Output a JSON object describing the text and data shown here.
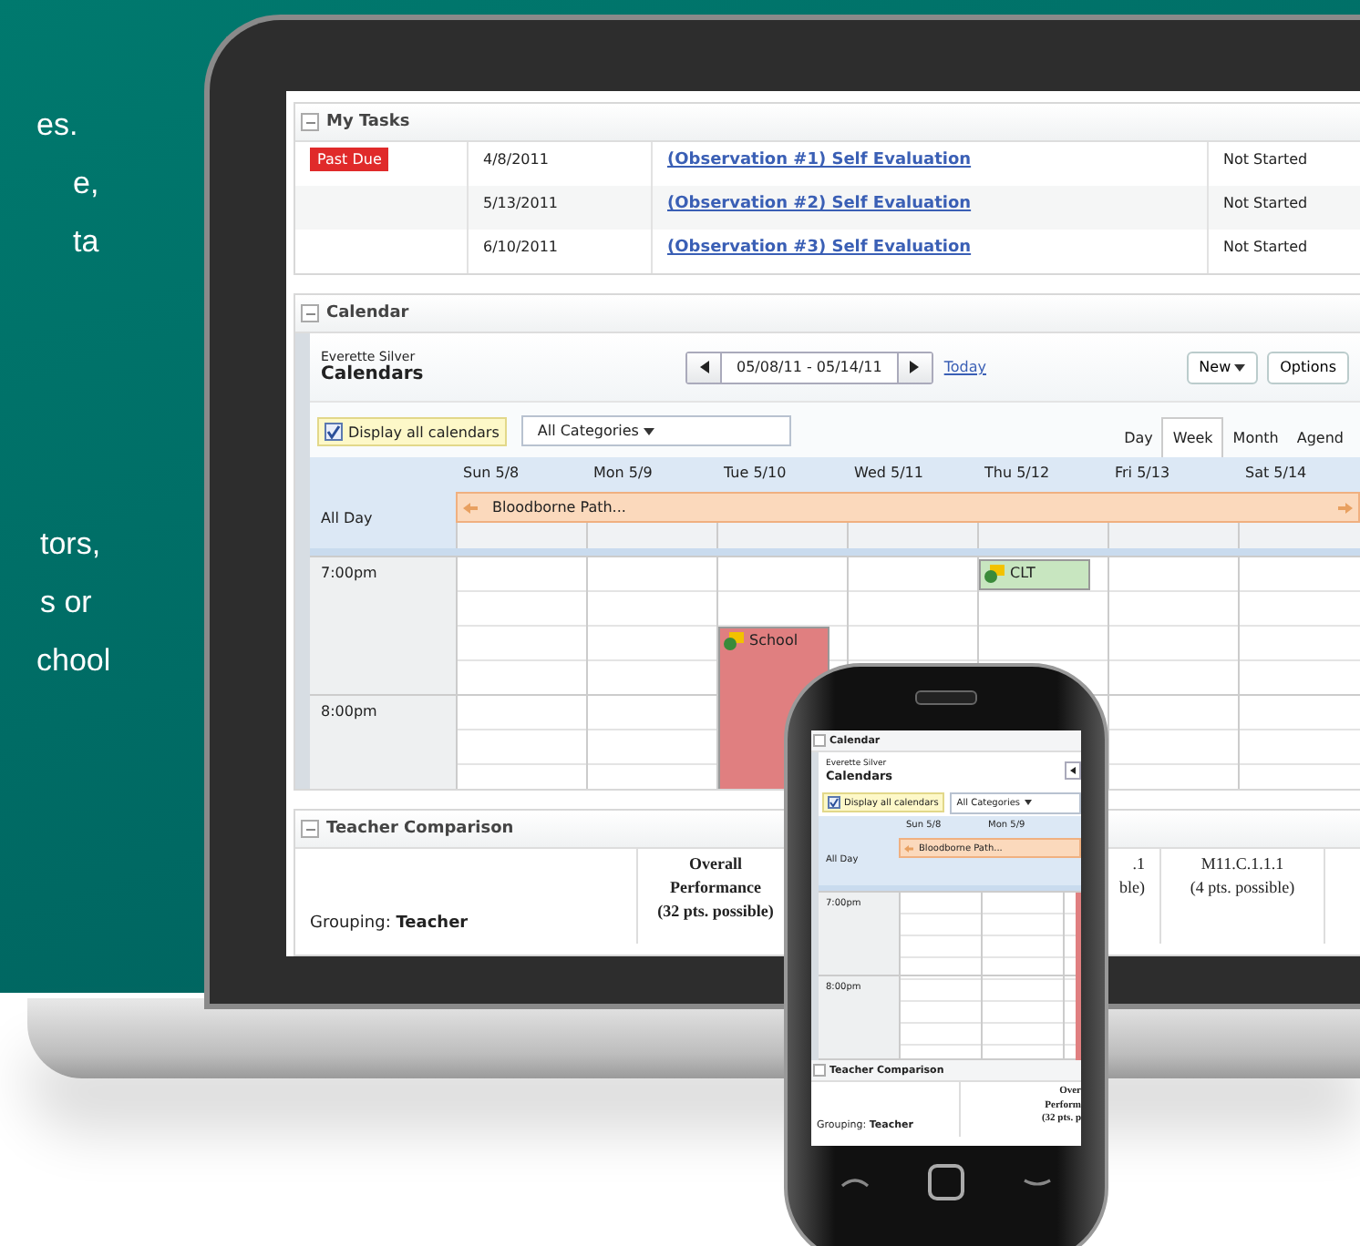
{
  "side_text": [
    "es.",
    "e,",
    "ta",
    "tors,",
    "s or",
    "chool"
  ],
  "tasks": {
    "title": "My Tasks",
    "rows": [
      {
        "status": "Past Due",
        "date": "4/8/2011",
        "task": "(Observation #1) Self Evaluation",
        "progress": "Not Started"
      },
      {
        "date": "5/13/2011",
        "task": "(Observation #2) Self Evaluation",
        "progress": "Not Started"
      },
      {
        "date": "6/10/2011",
        "task": "(Observation #3) Self Evaluation",
        "progress": "Not Started"
      }
    ]
  },
  "calendar": {
    "title": "Calendar",
    "owner": "Everette Silver",
    "heading": "Calendars",
    "date_range": "05/08/11 - 05/14/11",
    "today": "Today",
    "new_button": "New",
    "options_button": "Options",
    "display_all": {
      "label": "Display all calendars",
      "checked": true
    },
    "category": "All Categories",
    "views": [
      {
        "label": "Day",
        "selected": false
      },
      {
        "label": "Week",
        "selected": true
      },
      {
        "label": "Month",
        "selected": false
      },
      {
        "label": "Agend",
        "selected": false
      }
    ],
    "days": [
      {
        "label": "Sun 5/8"
      },
      {
        "label": "Mon 5/9"
      },
      {
        "label": "Tue 5/10",
        "events": [
          {
            "label": "School",
            "color": "#e07f80",
            "kind": "long"
          }
        ]
      },
      {
        "label": "Wed 5/11"
      },
      {
        "label": "Thu 5/12",
        "events": [
          {
            "label": "CLT",
            "color": "#c8e6c0",
            "kind": "short"
          }
        ]
      },
      {
        "label": "Fri 5/13"
      },
      {
        "label": "Sat 5/14"
      }
    ],
    "all_day_label": "All Day",
    "all_day_event": "Bloodborne Path...",
    "times": [
      "7:00pm",
      "8:00pm"
    ]
  },
  "comparison": {
    "title": "Teacher Comparison",
    "grouping": "Grouping: **Teacher**",
    "columns": [
      [
        "Overall",
        "Performance",
        "(32 pts. possible)"
      ],
      [
        ".1",
        "ble)"
      ],
      [
        "M11.C.1.1.1",
        "(4 pts. possible)"
      ]
    ]
  },
  "phone": {
    "calendar_title": "Calendar",
    "owner": "Everette Silver",
    "heading": "Calendars",
    "display_all": {
      "label": "Display all calendars",
      "checked": true
    },
    "category": "All Categories",
    "days": [
      "Sun 5/8",
      "Mon 5/9"
    ],
    "all_day_label": "All Day",
    "all_day_event": "Bloodborne Path...",
    "times": [
      "7:00pm",
      "8:00pm"
    ],
    "comparison_title": "Teacher Comparison",
    "grouping": "Grouping: **Teacher**",
    "column_lines": [
      "Over",
      "Perform",
      "(32 pts. p"
    ]
  }
}
